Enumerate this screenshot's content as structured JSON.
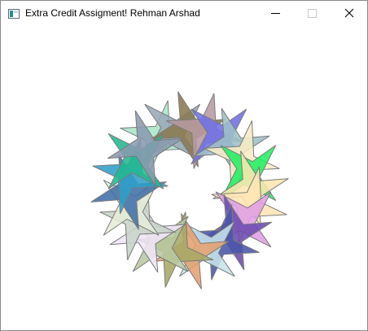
{
  "window": {
    "title": "Extra Credit Assigment! Rehman Arshad",
    "app_icon": "window-app-icon",
    "controls": {
      "minimize": "minimize-icon",
      "maximize": "maximize-icon",
      "close": "close-icon"
    }
  },
  "drawing": {
    "shape": "four-point-star",
    "count": 24,
    "colors": [
      "#a8e6c7",
      "#9aa8b8",
      "#8a7a4e",
      "#b79aa0",
      "#6f6fe6",
      "#9dc0c8",
      "#f7ecc4",
      "#1ff060",
      "#fde6b0",
      "#ffe5b4",
      "#e09ee6",
      "#6a4ab0",
      "#4a55a8",
      "#c7e4ea",
      "#e4a070",
      "#a6a864",
      "#b8c8a0",
      "#efe6f7",
      "#c8d4c8",
      "#e6ecd8",
      "#4070a8",
      "#2f9ec8",
      "#22b890",
      "#8a9ab0"
    ],
    "outline_color": "#7a7a7a"
  }
}
